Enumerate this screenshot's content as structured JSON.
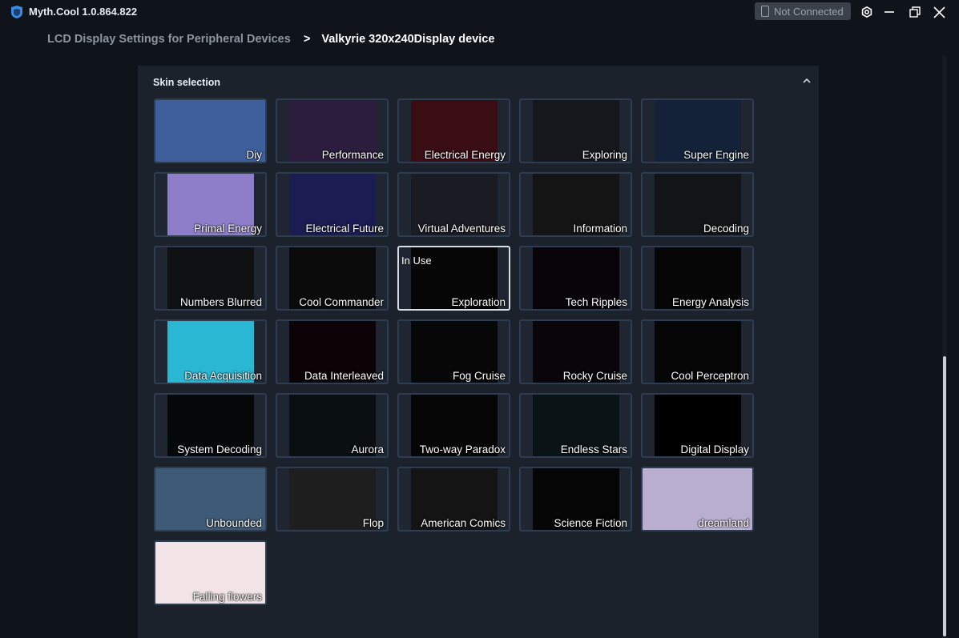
{
  "app": {
    "title": "Myth.Cool 1.0.864.822",
    "connection_status": "Not Connected"
  },
  "breadcrumb": {
    "parent": "LCD Display Settings for Peripheral Devices",
    "separator": ">",
    "current": "Valkyrie 320x240Display device"
  },
  "panel": {
    "title": "Skin selection",
    "in_use_label": "In Use"
  },
  "skins": [
    {
      "label": "Diy",
      "active": false,
      "full": true,
      "bg": "#3f5f9c"
    },
    {
      "label": "Performance",
      "active": false,
      "full": false,
      "bg": "#2c1d3e"
    },
    {
      "label": "Electrical Energy",
      "active": false,
      "full": false,
      "bg": "#3a0d14"
    },
    {
      "label": "Exploring",
      "active": false,
      "full": false,
      "bg": "#15171c"
    },
    {
      "label": "Super Engine",
      "active": false,
      "full": false,
      "bg": "#132238"
    },
    {
      "label": "Primal Energy",
      "active": false,
      "full": false,
      "bg": "#8e7ec9"
    },
    {
      "label": "Electrical Future",
      "active": false,
      "full": false,
      "bg": "#1b1d52"
    },
    {
      "label": "Virtual Adventures",
      "active": false,
      "full": false,
      "bg": "#1b1b24"
    },
    {
      "label": "Information",
      "active": false,
      "full": false,
      "bg": "#141414"
    },
    {
      "label": "Decoding",
      "active": false,
      "full": false,
      "bg": "#121417"
    },
    {
      "label": "Numbers Blurred",
      "active": false,
      "full": false,
      "bg": "#0f1113"
    },
    {
      "label": "Cool Commander",
      "active": false,
      "full": false,
      "bg": "#0b0b0b"
    },
    {
      "label": "Exploration",
      "active": true,
      "full": false,
      "bg": "#050505"
    },
    {
      "label": "Tech Ripples",
      "active": false,
      "full": false,
      "bg": "#070307"
    },
    {
      "label": "Energy Analysis",
      "active": false,
      "full": false,
      "bg": "#060606"
    },
    {
      "label": "Data Acquisition",
      "active": false,
      "full": false,
      "bg": "#2ab7d3"
    },
    {
      "label": "Data Interleaved",
      "active": false,
      "full": false,
      "bg": "#0c0306"
    },
    {
      "label": "Fog Cruise",
      "active": false,
      "full": false,
      "bg": "#070707"
    },
    {
      "label": "Rocky Cruise",
      "active": false,
      "full": false,
      "bg": "#080608"
    },
    {
      "label": "Cool Perceptron",
      "active": false,
      "full": false,
      "bg": "#050505"
    },
    {
      "label": "System Decoding",
      "active": false,
      "full": false,
      "bg": "#050809"
    },
    {
      "label": "Aurora",
      "active": false,
      "full": false,
      "bg": "#0a0f10"
    },
    {
      "label": "Two-way Paradox",
      "active": false,
      "full": false,
      "bg": "#050505"
    },
    {
      "label": "Endless Stars",
      "active": false,
      "full": false,
      "bg": "#0a1416"
    },
    {
      "label": "Digital Display",
      "active": false,
      "full": false,
      "bg": "#000000"
    },
    {
      "label": "Unbounded",
      "active": false,
      "full": true,
      "bg": "#3e5a76"
    },
    {
      "label": "Flop",
      "active": false,
      "full": false,
      "bg": "#1e1e1e"
    },
    {
      "label": "American Comics",
      "active": false,
      "full": false,
      "bg": "#141414"
    },
    {
      "label": "Science Fiction",
      "active": false,
      "full": false,
      "bg": "#050505"
    },
    {
      "label": "dreamland",
      "active": false,
      "full": true,
      "bg": "#b9aed0"
    },
    {
      "label": "Falling flowers",
      "active": false,
      "full": true,
      "bg": "#f2e3e6"
    }
  ]
}
